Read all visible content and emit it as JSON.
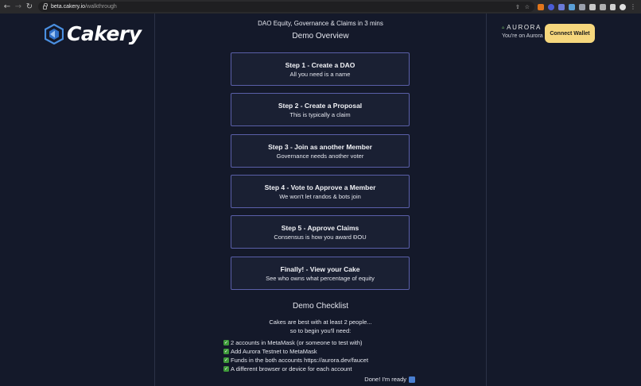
{
  "browser": {
    "url_host": "beta.cakery.io",
    "url_path": "/walkthrough"
  },
  "header": {
    "logo_text": "Cakery",
    "network_name": "AURORA",
    "network_status": "You're on Aurora",
    "connect_label": "Connect Wallet"
  },
  "main": {
    "subtitle": "DAO Equity, Governance & Claims in 3 mins",
    "overview_title": "Demo Overview",
    "steps": [
      {
        "title": "Step 1 - Create a DAO",
        "desc": "All you need is a name"
      },
      {
        "title": "Step 2 - Create a Proposal",
        "desc": "This is typically a claim"
      },
      {
        "title": "Step 3 - Join as another Member",
        "desc": "Governance needs another voter"
      },
      {
        "title": "Step 4 - Vote to Approve a Member",
        "desc": "We won't let randos & bots join"
      },
      {
        "title": "Step 5 - Approve Claims",
        "desc": "Consensus is how you award ĐOU"
      },
      {
        "title": "Finally! - View your Cake",
        "desc": "See who owns what percentage of equity"
      }
    ],
    "checklist_title": "Demo Checklist",
    "intro_line1": "Cakes are best with at least 2 people...",
    "intro_line2": "so to begin you'll need:",
    "checklist": [
      "2 accounts in MetaMask (or someone to test with)",
      "Add Aurora Testnet to MetaMask",
      "Funds in the both accounts https://aurora.dev/faucet",
      "A different browser or device for each account"
    ],
    "done_label": "Done! I'm ready"
  },
  "colors": {
    "background": "#14192a",
    "card_border": "#5a5fa8",
    "accent_button": "#f6d77d",
    "logo_blue": "#4a8fe0"
  }
}
